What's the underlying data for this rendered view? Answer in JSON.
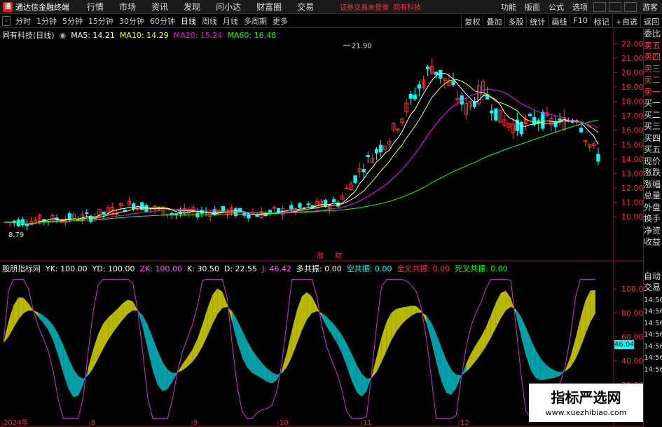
{
  "app": {
    "name": "通达信金融终端",
    "warning": "证券交易未登录",
    "stock": "同有科技"
  },
  "main_menu": [
    "行情",
    "市场",
    "资讯",
    "发现",
    "问小达",
    "财富圈",
    "交易"
  ],
  "right_menu": [
    "功能",
    "版面",
    "公式",
    "选项",
    "游客"
  ],
  "periods": [
    "分时",
    "1分钟",
    "5分钟",
    "15分钟",
    "30分钟",
    "60分钟",
    "日线",
    "周线",
    "月线",
    "多周期",
    "更多"
  ],
  "active_period": "日线",
  "toolbar_right": [
    "复权",
    "叠加",
    "多股",
    "统计",
    "画线",
    "F10",
    "标记",
    "+自选",
    "返回"
  ],
  "ma_legend": {
    "title": "同有科技(日线)",
    "items": [
      {
        "label": "MA5: 14.21",
        "color": "#ffffff"
      },
      {
        "label": "MA10: 14.29",
        "color": "#ffff00"
      },
      {
        "label": "MA20: 15.24",
        "color": "#ff00ff"
      },
      {
        "label": "MA60: 16.48",
        "color": "#00ff00"
      }
    ]
  },
  "ind_legend": {
    "title": "殷朋指标网",
    "items": [
      {
        "label": "YK: 100.00",
        "color": "#ffffff"
      },
      {
        "label": "YD: 100.00",
        "color": "#ffffff"
      },
      {
        "label": "ZK: 100.00",
        "color": "#ff55ff"
      },
      {
        "label": "K: 30.50",
        "color": "#ffffff"
      },
      {
        "label": "D: 22.55",
        "color": "#ffffff"
      },
      {
        "label": "J: 46.42",
        "color": "#ff55ff"
      },
      {
        "label": "多共振: 0.00",
        "color": "#ffffff"
      },
      {
        "label": "空共振: 0.00",
        "color": "#00ffff"
      },
      {
        "label": "金叉共振: 0.00",
        "color": "#ff3333"
      },
      {
        "label": "死叉共振: 0.00",
        "color": "#00ff00"
      }
    ]
  },
  "price_axis": [
    "22.00",
    "21.00",
    "20.00",
    "19.00",
    "18.00",
    "17.00",
    "16.00",
    "15.00",
    "14.00",
    "13.00",
    "12.00",
    "11.00",
    "10.00"
  ],
  "ind_axis": [
    "100.0",
    "80.00",
    "60.00",
    "40.00",
    "20.00"
  ],
  "ind_badge": "46.04",
  "time_axis": [
    "2024年",
    "8",
    "9",
    "10",
    "11",
    "12"
  ],
  "markers": {
    "high": "21.90",
    "low": "8.79",
    "zhang": "涨",
    "cai": "财"
  },
  "right_panel": [
    "委比",
    "卖五",
    "卖四",
    "卖三",
    "卖二",
    "卖一",
    "买一",
    "买二",
    "买三",
    "买四",
    "买五",
    "现价",
    "涨跌",
    "涨幅",
    "总量",
    "外盘",
    "换手",
    "净资",
    "收益",
    "自动",
    "交易"
  ],
  "right_times": [
    "14:56",
    "14:56",
    "14:56",
    "14:56",
    "14:56",
    "14:56",
    "14:56"
  ],
  "watermark": {
    "line1": "指标严选网",
    "line2": "www.xuezhibiao.com"
  },
  "colors": {
    "up": "#ff3333",
    "down": "#00ffff",
    "ma5": "#ffffff",
    "ma10": "#ffff00",
    "ma20": "#ff00ff",
    "ma60": "#00ff00",
    "yellow_fill": "#b8b800",
    "cyan_fill": "#00a0a8"
  }
}
